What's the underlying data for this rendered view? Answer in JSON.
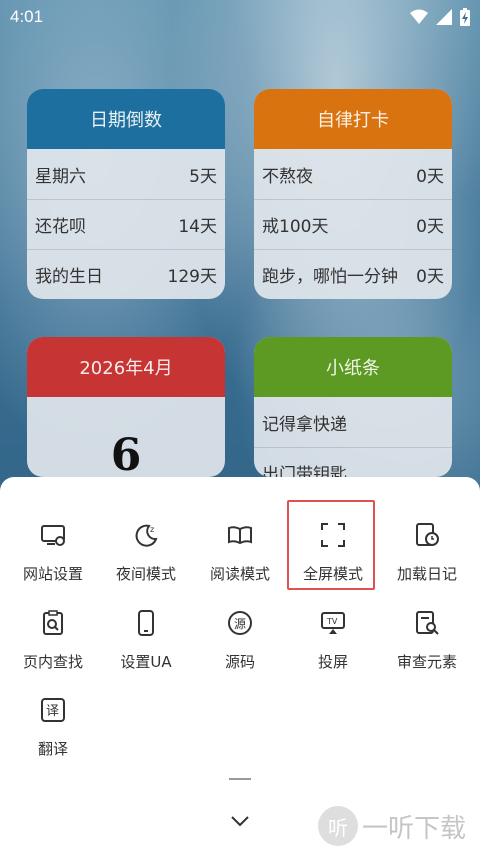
{
  "status_bar": {
    "time": "4:01"
  },
  "cards": {
    "countdown": {
      "title": "日期倒数",
      "rows": [
        {
          "label": "星期六",
          "value": "5天"
        },
        {
          "label": "还花呗",
          "value": "14天"
        },
        {
          "label": "我的生日",
          "value": "129天"
        }
      ]
    },
    "checkin": {
      "title": "自律打卡",
      "rows": [
        {
          "label": "不熬夜",
          "value": "0天"
        },
        {
          "label": "戒100天",
          "value": "0天"
        },
        {
          "label": "跑步，哪怕一分钟",
          "value": "0天"
        }
      ]
    },
    "calendar": {
      "title": "2026年4月",
      "day": "6"
    },
    "notes": {
      "title": "小纸条",
      "items": [
        "记得拿快递",
        "出门带钥匙"
      ]
    }
  },
  "menu": {
    "items": [
      {
        "label": "网站设置",
        "icon": "site-settings-icon"
      },
      {
        "label": "夜间模式",
        "icon": "night-mode-icon"
      },
      {
        "label": "阅读模式",
        "icon": "reading-mode-icon"
      },
      {
        "label": "全屏模式",
        "icon": "fullscreen-icon"
      },
      {
        "label": "加载日记",
        "icon": "load-log-icon"
      },
      {
        "label": "页内查找",
        "icon": "find-in-page-icon"
      },
      {
        "label": "设置UA",
        "icon": "set-ua-icon"
      },
      {
        "label": "源码",
        "icon": "source-code-icon"
      },
      {
        "label": "投屏",
        "icon": "cast-icon"
      },
      {
        "label": "审查元素",
        "icon": "inspect-element-icon"
      },
      {
        "label": "翻译",
        "icon": "translate-icon"
      }
    ]
  },
  "watermark": {
    "logo_char": "听",
    "text": "一听下载"
  },
  "colors": {
    "countdown_header": "#1d6f9f",
    "checkin_header": "#d8730f",
    "calendar_header": "#c73434",
    "notes_header": "#5c9a23",
    "highlight_border": "#e05151"
  }
}
